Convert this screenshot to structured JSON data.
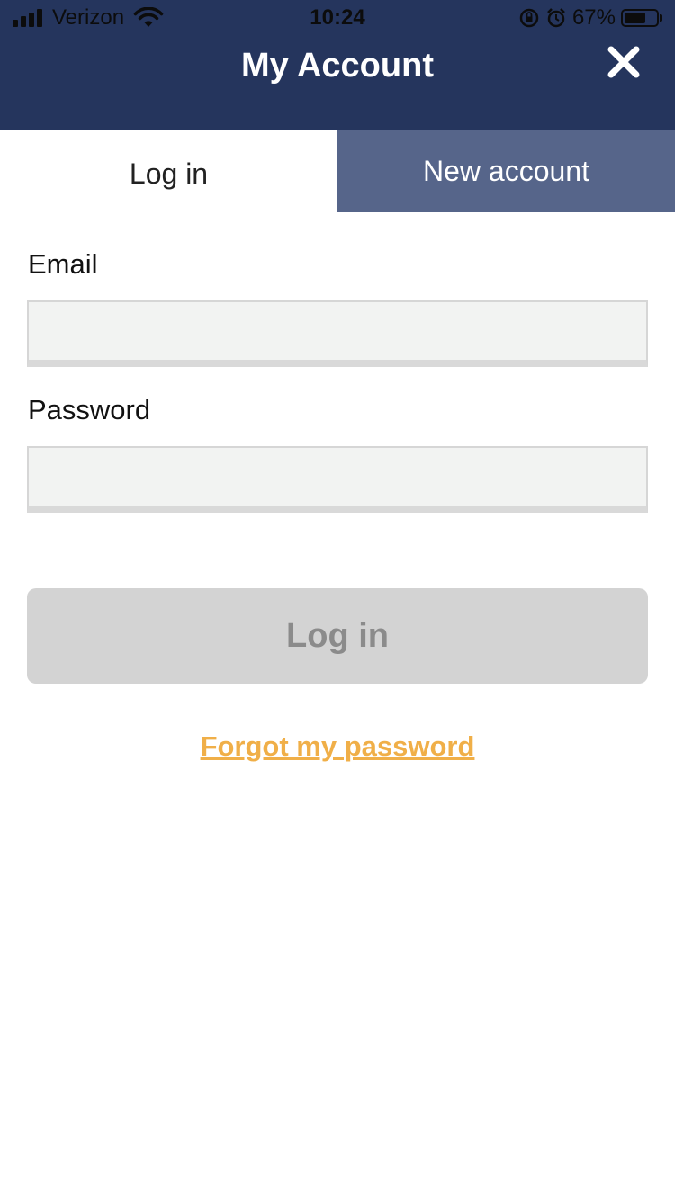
{
  "status_bar": {
    "carrier": "Verizon",
    "time": "10:24",
    "battery_percent": "67%",
    "battery_level": 0.67,
    "icons": [
      "signal-icon",
      "wifi-icon",
      "rotation-lock-icon",
      "alarm-icon",
      "battery-icon"
    ]
  },
  "header": {
    "title": "My Account",
    "close_icon": "close-icon",
    "background": "#25355d"
  },
  "tabs": [
    {
      "label": "Log in",
      "active": true
    },
    {
      "label": "New account",
      "active": false
    }
  ],
  "form": {
    "email_label": "Email",
    "email_value": "",
    "password_label": "Password",
    "password_value": "",
    "submit_label": "Log in",
    "forgot_label": "Forgot my password"
  },
  "colors": {
    "header": "#25355d",
    "inactive_tab": "#56658a",
    "button_disabled": "#d3d3d3",
    "link": "#f0af48"
  }
}
